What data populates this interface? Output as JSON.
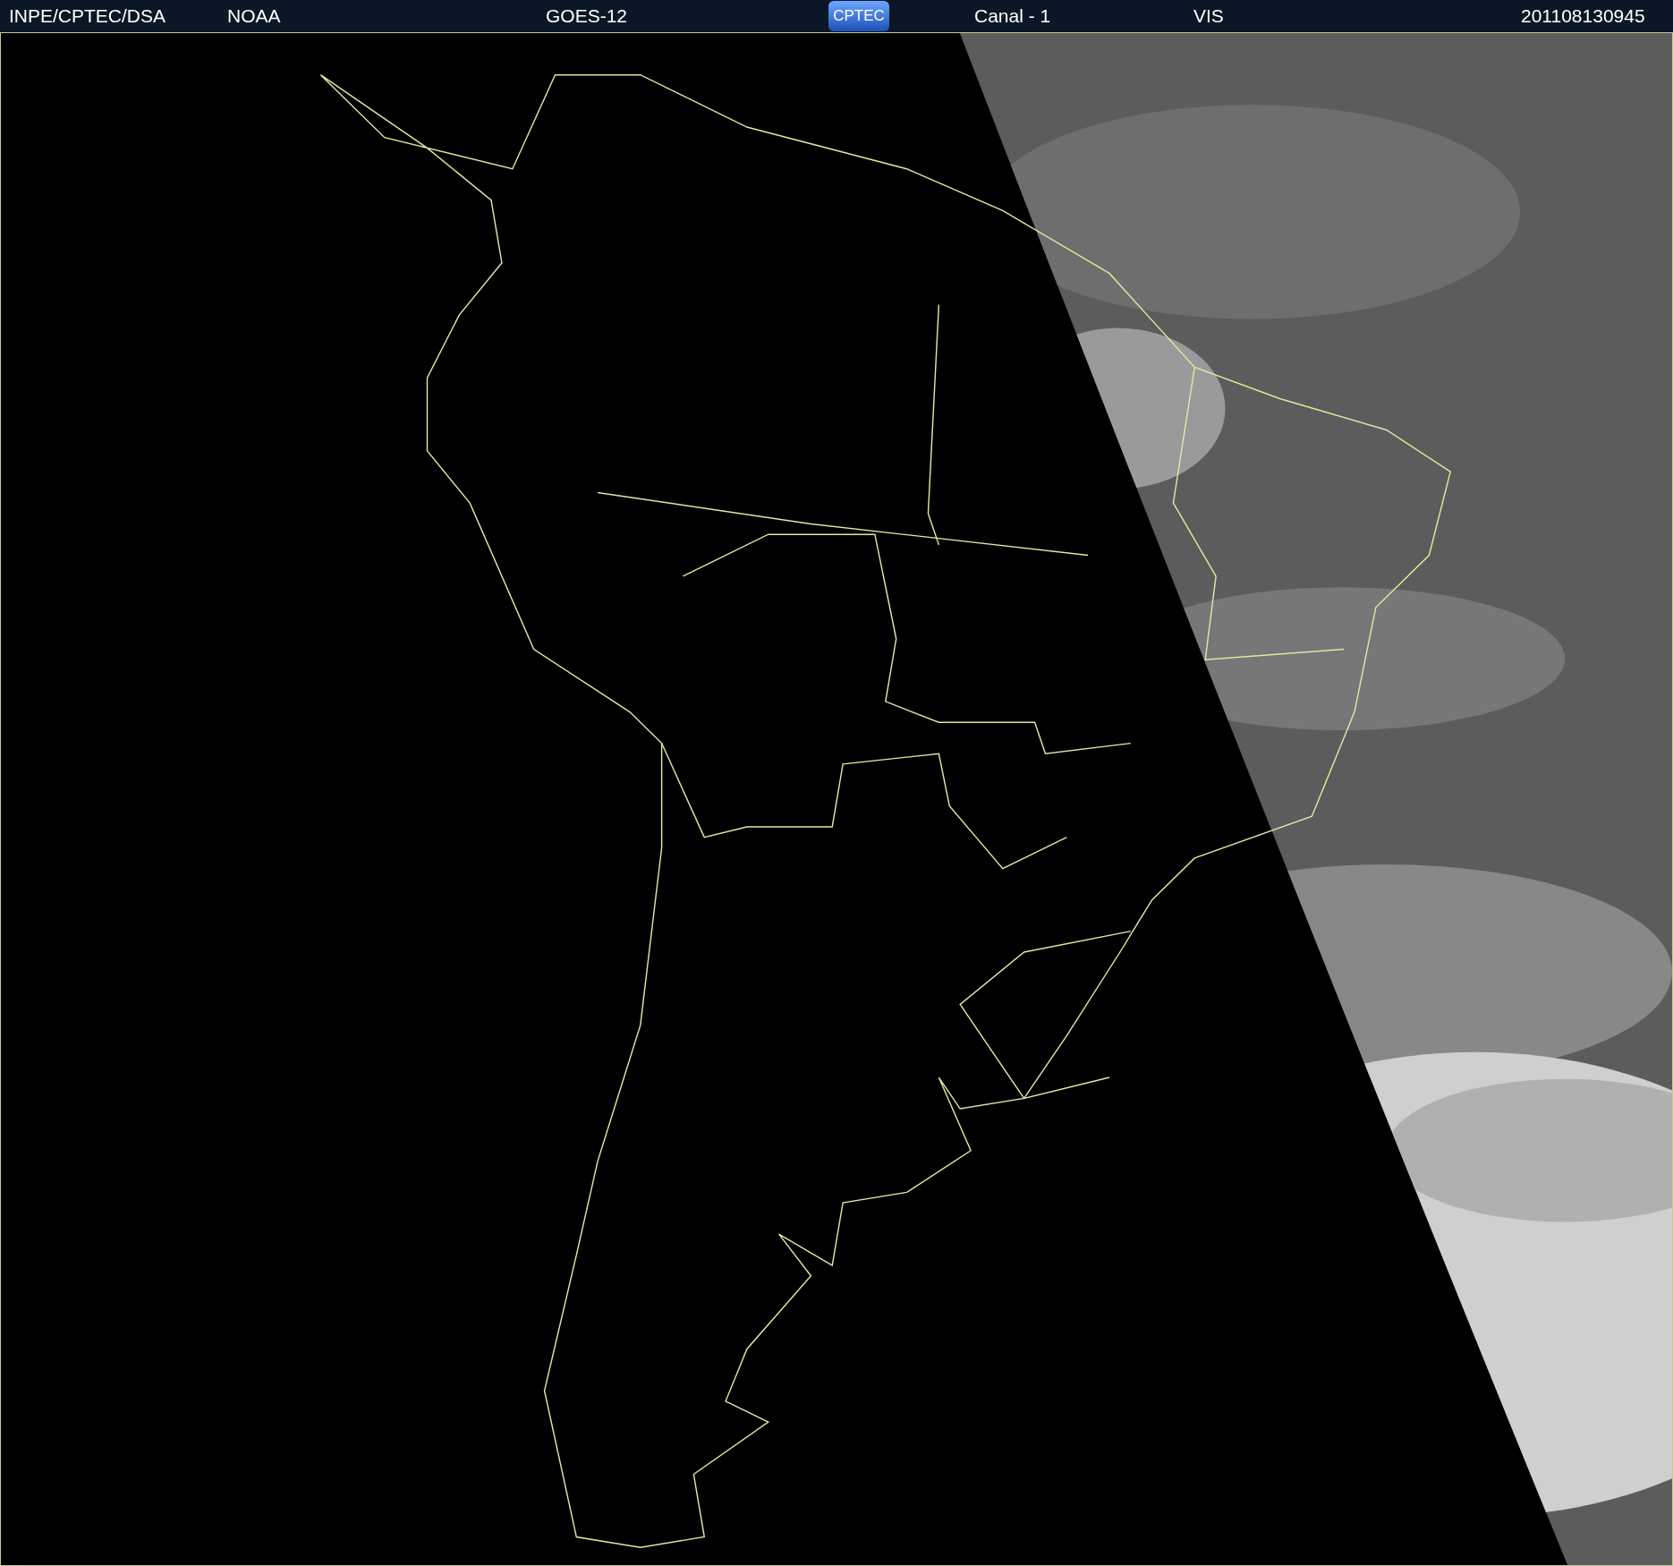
{
  "header": {
    "source": "INPE/CPTEC/DSA",
    "agency": "NOAA",
    "satellite": "GOES-12",
    "logo": "CPTEC",
    "channel": "Canal - 1",
    "band": "VIS",
    "timestamp": "201108130945"
  }
}
